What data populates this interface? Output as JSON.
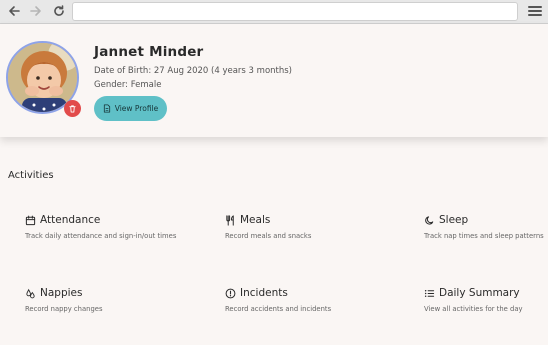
{
  "browser": {
    "url": "",
    "icons": [
      "back-arrow-icon",
      "forward-arrow-icon",
      "reload-icon",
      "hamburger-menu-icon"
    ]
  },
  "profile": {
    "name": "Jannet Minder",
    "dob": "Date of Birth: 27 Aug 2020  (4 years 3 months)",
    "gender": "Gender: Female",
    "view_profile_label": "View Profile",
    "colors": {
      "accent": "#5fc0c7",
      "delete": "#e24b4b",
      "avatar_ring": "#8ea3e8"
    }
  },
  "activities": {
    "title": "Activities",
    "items": [
      {
        "title": "Attendance",
        "desc": "Track daily attendance and sign-in/out times",
        "icon": "calendar-icon"
      },
      {
        "title": "Meals",
        "desc": "Record meals and snacks",
        "icon": "fork-knife-icon"
      },
      {
        "title": "Sleep",
        "desc": "Track nap times and sleep patterns",
        "icon": "moon-icon"
      },
      {
        "title": "Nappies",
        "desc": "Record nappy changes",
        "icon": "droplets-icon"
      },
      {
        "title": "Incidents",
        "desc": "Record accidents and incidents",
        "icon": "alert-circle-icon"
      },
      {
        "title": "Daily Summary",
        "desc": "View all activities for the day",
        "icon": "list-icon"
      }
    ]
  }
}
